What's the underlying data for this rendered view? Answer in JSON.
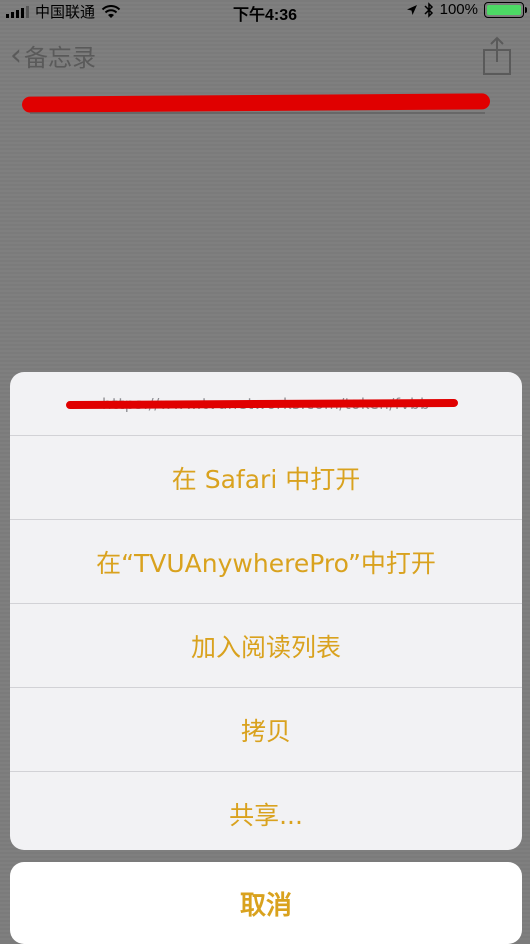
{
  "status_bar": {
    "carrier": "中国联通",
    "time": "下午4:36",
    "battery": "100%"
  },
  "navbar": {
    "back_label": "备忘录",
    "back_icon": "chevron-left-icon",
    "share_icon": "share-icon"
  },
  "sheet": {
    "url": "https://www.tvunetworks.com/token/fvbb",
    "items": [
      {
        "label": "在 Safari 中打开"
      },
      {
        "label": "在“TVUAnywherePro”中打开"
      },
      {
        "label": "加入阅读列表"
      },
      {
        "label": "拷贝"
      },
      {
        "label": "共享..."
      }
    ],
    "cancel_label": "取消"
  },
  "colors": {
    "accent": "#d9a21e",
    "redaction": "#e00000",
    "battery_fill": "#4cd964"
  }
}
